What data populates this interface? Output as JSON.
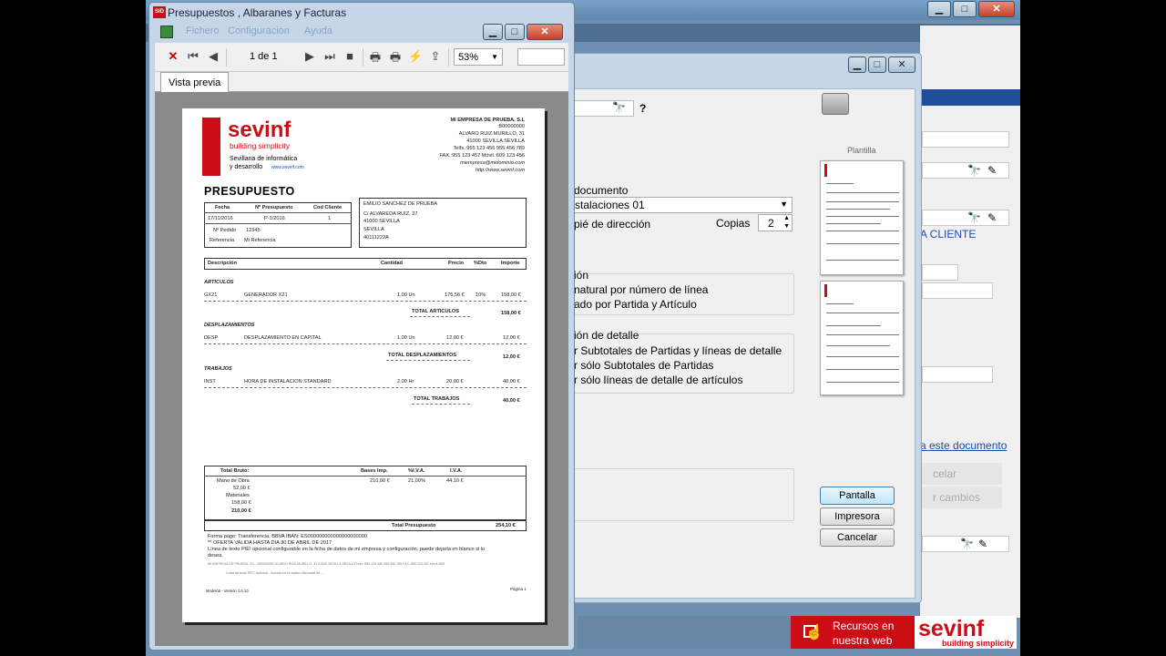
{
  "preview": {
    "title": "Presupuestos , Albaranes y Facturas",
    "menu_ghost": [
      "Fichero",
      "Configuración",
      "Ayuda"
    ],
    "page_indicator": "1 de 1",
    "zoom": "53%",
    "tab_label": "Vista previa",
    "icons": [
      "close-icon",
      "first-page-icon",
      "prev-page-icon",
      "next-page-icon",
      "last-page-icon",
      "stop-icon",
      "print-icon",
      "print-setup-icon",
      "quick-print-icon",
      "export-icon",
      "dropdown-arrow-icon"
    ]
  },
  "document": {
    "logo": {
      "brand": "sevinf",
      "tagline": "building simplicity",
      "sub1": "Sevillana de informática",
      "sub2": "y desarrollo",
      "web": "www.sevinf.com"
    },
    "company": [
      "MI EMPRESA DE PRUEBA, S.L",
      "B00000000",
      "ALVARO RUIZ MURILLO, 31",
      "41000 SEVILLA SEVILLA",
      "Telfs.:955 123 456    955 456 789",
      "FAX.:955 123 457   Móvil.:609 123 456",
      "miempresa@midominio.com",
      "http://www.sevinf.com"
    ],
    "doc_title": "PRESUPUESTO",
    "header_cols": [
      "Fecha",
      "Nº Presupuesto",
      "Cod Cliente"
    ],
    "header_vals": [
      "17/11/2016",
      "P-1/2016",
      "1"
    ],
    "pedido_label": "Nº Pedido",
    "pedido_val": "12345",
    "referencia_label": "Referencia",
    "referencia_val": "Mi Referencia",
    "client": [
      "EMILIO SANCHEZ DE PRUEBA",
      "C/ ALVAREDA RUIZ, 37",
      "41000    SEVILLA",
      "SEVILLA",
      "40111222A"
    ],
    "table_cols": [
      "Descripción",
      "Cantidad",
      "Precio",
      "%Dto",
      "Importe"
    ],
    "sections": [
      {
        "name": "ARTICULOS",
        "code": "GX21",
        "desc": "GENERADOR X21",
        "qty": "1,00 Un",
        "price": "175,56 €",
        "dto": "10%",
        "amount": "158,00 €",
        "total_label": "TOTAL ARTICULOS",
        "total": "158,00 €"
      },
      {
        "name": "DESPLAZAMIENTOS",
        "code": "DESP",
        "desc": "DESPLAZAMIENTO EN CAPITAL",
        "qty": "1,00 Un",
        "price": "12,00 €",
        "dto": "",
        "amount": "12,00 €",
        "total_label": "TOTAL DESPLAZAMIENTOS",
        "total": "12,00 €"
      },
      {
        "name": "TRABAJOS",
        "code": "INST",
        "desc": "HORA DE INSTALACION STANDARD",
        "qty": "2,00 Hr",
        "price": "20,00 €",
        "dto": "",
        "amount": "40,00 €",
        "total_label": "TOTAL TRABAJOS",
        "total": "40,00 €"
      }
    ],
    "totals_cols": [
      "Total Bruto:",
      "Bases Imp.",
      "%I.V.A.",
      "I.V.A."
    ],
    "bruto_lines": [
      "Mano de Obra",
      "52,00 €",
      "Materiales",
      "158,00 €",
      "210,00 €"
    ],
    "bases": "210,00 €",
    "iva_pct": "21,00%",
    "iva": "44,10 €",
    "total_label": "Total Presupuesto",
    "total": "254,10 €",
    "forma_pago": "Forma pago: Transferencia, BBVA IBAN: ES000000000000000000000",
    "oferta": "** OFERTA VALIDA HASTA DIA 30 DE ABRIL DE 2017",
    "nota1": "Línea de texto PIE! opcional configurable en la ficha de datos de mi empresa y configuración, puede dejarla en blanco si lo",
    "nota2": "desea.",
    "legal1": "MI EMPRESA DE PRUEBA, S.L., B00000000 ALVARO RUIZ MURILLO, 31 41000 SEVILLA SEVILLA Telfs.:955 123 456 955 456 789 FAX.:955 123 457 Móvil.:609",
    "legal2": "Línea de texto PIE2 opcional - Inscrita en el registro Mercantil de ...",
    "footer_left": "Modelo5 - Versión 1.0.10",
    "footer_right": "Página 1"
  },
  "print_dialog": {
    "icons": [
      "binoculars-icon",
      "help-icon",
      "printer-icon"
    ],
    "help_label": "?",
    "plantilla_label": "Plantilla",
    "documento_label": "documento",
    "documento_value": "stalaciones 01",
    "pie_label": "pié de dirección",
    "copias_label": "Copias",
    "copias_value": "2",
    "order_title": "ión",
    "order_options": [
      "natural por número de línea",
      "ado por Partida y Artículo"
    ],
    "detail_title": "ión de detalle",
    "detail_options": [
      "r Subtotales de Partidas y líneas de detalle",
      "r sólo Subtotales de Partidas",
      "r sólo líneas de detalle de artículos"
    ],
    "buttons": [
      "Pantalla",
      "Impresora",
      "Cancelar"
    ]
  },
  "background": {
    "cliente_label": "A CLIENTE",
    "link_label": "a este documento",
    "ghost_cancel": "celar",
    "ghost_changes": "r cambios",
    "recursos_line1": "Recursos en",
    "recursos_line2": "nuestra web",
    "logo_brand": "sevinf",
    "logo_tagline": "building simplicity"
  },
  "colors": {
    "brand_red": "#cc0d15",
    "header_blue": "#1f4e9c",
    "link_blue": "#1a4ca8"
  }
}
